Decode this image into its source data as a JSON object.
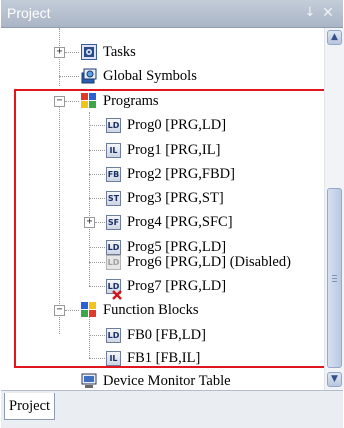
{
  "panel": {
    "title": "Project",
    "pin_glyph": "↓",
    "close_glyph": "✕"
  },
  "tree": {
    "tasks": {
      "label": "Tasks",
      "expander": "+"
    },
    "global_symbols": {
      "label": "Global Symbols"
    },
    "programs": {
      "label": "Programs",
      "expander": "−",
      "items": [
        {
          "label": "Prog0 [PRG,LD]",
          "icon_text": "LD"
        },
        {
          "label": "Prog1 [PRG,IL]",
          "icon_text": "IL"
        },
        {
          "label": "Prog2 [PRG,FBD]",
          "icon_text": "FB"
        },
        {
          "label": "Prog3 [PRG,ST]",
          "icon_text": "ST"
        },
        {
          "label": "Prog4 [PRG,SFC]",
          "icon_text": "SF",
          "expander": "+"
        },
        {
          "label": "Prog5 [PRG,LD]",
          "icon_text": "LD"
        },
        {
          "label": "Prog6 [PRG,LD] (Disabled)",
          "icon_text": "LD"
        },
        {
          "label": "Prog7 [PRG,LD]",
          "icon_text": "LD"
        }
      ]
    },
    "function_blocks": {
      "label": "Function Blocks",
      "expander": "−",
      "items": [
        {
          "label": "FB0 [FB,LD]",
          "icon_text": "LD"
        },
        {
          "label": "FB1 [FB,IL]",
          "icon_text": "IL"
        }
      ]
    },
    "device_monitor_table": {
      "label": "Device Monitor Table"
    }
  },
  "scrollbar": {
    "up_glyph": "▲",
    "down_glyph": "▼"
  },
  "tabs": [
    {
      "label": "Project"
    }
  ],
  "colors": {
    "highlight_border": "#e2141d",
    "titlebar": "#aab5c6"
  }
}
